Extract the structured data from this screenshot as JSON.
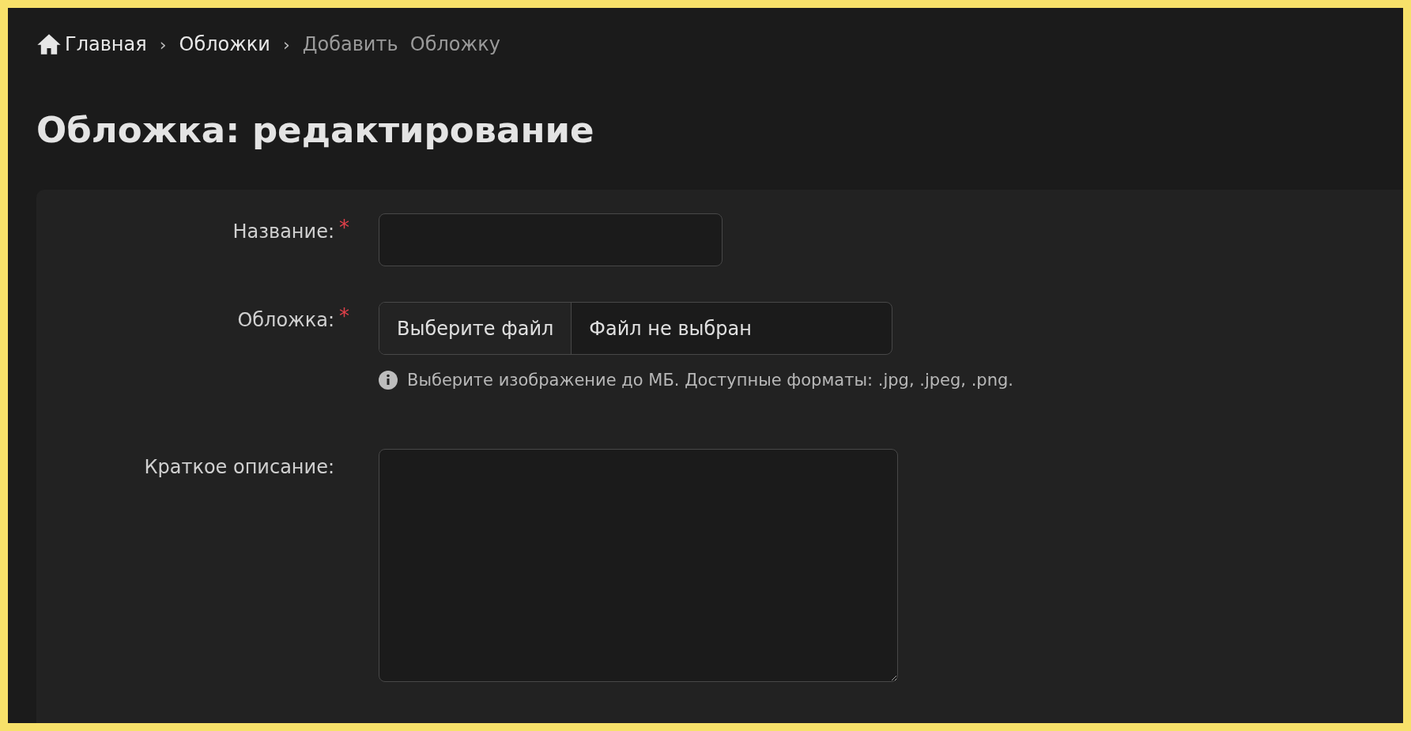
{
  "breadcrumbs": [
    {
      "label": "Главная",
      "kind": "home"
    },
    {
      "separator": "›",
      "label": "Обложки",
      "kind": "link"
    },
    {
      "separator": "›",
      "label": "Добавить  Обложку",
      "kind": "current"
    }
  ],
  "title": "Обложка: редактирование",
  "form": {
    "fields": [
      {
        "kind": "text",
        "label": "Название:",
        "required_mark": "*"
      },
      {
        "kind": "file",
        "label": "Обложка:",
        "required_mark": "*",
        "button": "Выберите файл",
        "value": "Файл не выбран",
        "hint": "Выберите изображение до МБ. Доступные форматы: .jpg, .jpeg, .png."
      },
      {
        "kind": "textarea",
        "label": "Краткое описание:"
      }
    ]
  }
}
